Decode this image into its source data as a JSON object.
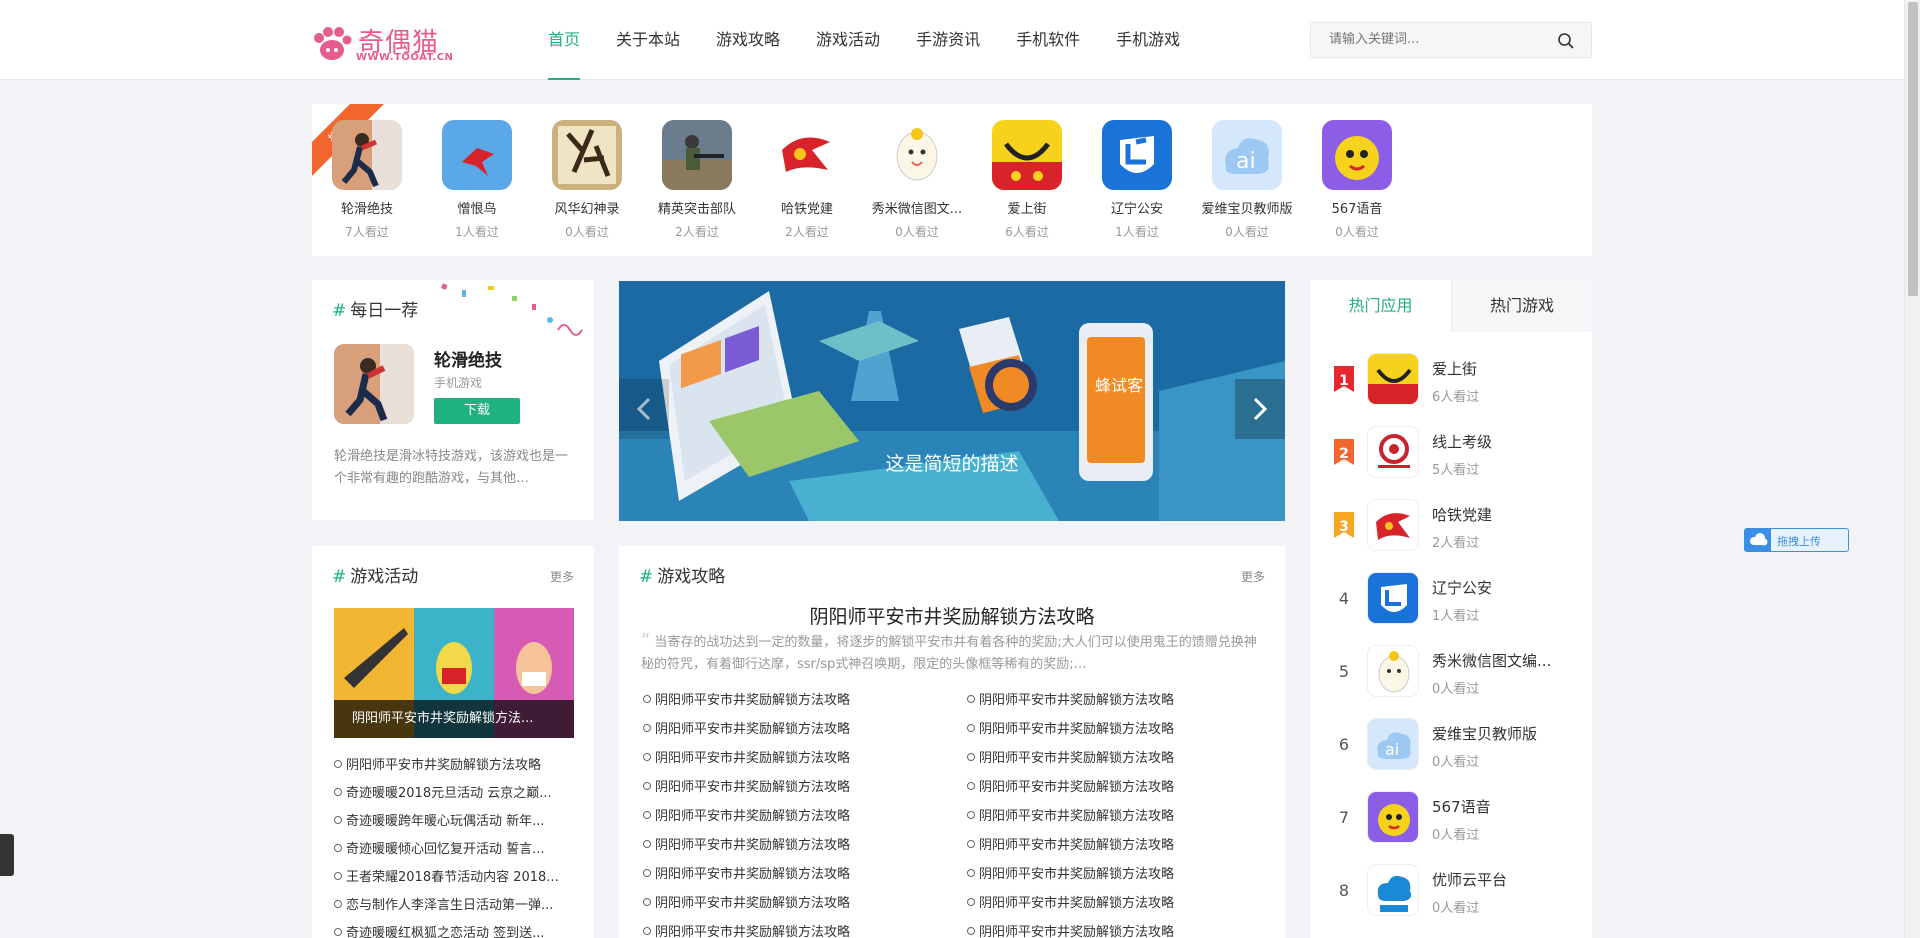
{
  "header": {
    "logo_text": "奇偶猫",
    "logo_url": "WWW.TOOAT.CN",
    "nav": [
      "首页",
      "关于本站",
      "游戏攻略",
      "游戏活动",
      "手游资讯",
      "手机软件",
      "手机游戏"
    ],
    "search_placeholder": "请输入关键词..."
  },
  "recommend": {
    "ribbon": "推荐",
    "items": [
      {
        "name": "轮滑绝技",
        "views": "7人看过"
      },
      {
        "name": "憎恨鸟",
        "views": "1人看过"
      },
      {
        "name": "风华幻神录",
        "views": "0人看过"
      },
      {
        "name": "精英突击部队",
        "views": "2人看过"
      },
      {
        "name": "哈铁党建",
        "views": "2人看过"
      },
      {
        "name": "秀米微信图文...",
        "views": "0人看过"
      },
      {
        "name": "爱上街",
        "views": "6人看过"
      },
      {
        "name": "辽宁公安",
        "views": "1人看过"
      },
      {
        "name": "爱维宝贝教师版",
        "views": "0人看过"
      },
      {
        "name": "567语音",
        "views": "0人看过"
      }
    ]
  },
  "daily": {
    "title": "每日一荐",
    "game_name": "轮滑绝技",
    "category": "手机游戏",
    "download_label": "下载",
    "description": "轮滑绝技是滑冰特技游戏，该游戏也是一个非常有趣的跑酷游戏，与其他…"
  },
  "banner": {
    "caption": "这是简短的描述",
    "phone_sign": "蜂试客"
  },
  "activity": {
    "title": "游戏活动",
    "more": "更多",
    "cover_title": "阴阳师平安市井奖励解锁方法...",
    "items": [
      "阴阳师平安市井奖励解锁方法攻略",
      "奇迹暖暖2018元旦活动 云京之巅...",
      "奇迹暖暖跨年暖心玩偶活动 新年...",
      "奇迹暖暖倾心回忆复开活动 誓言...",
      "王者荣耀2018春节活动内容 2018...",
      "恋与制作人李泽言生日活动第一弹...",
      "奇迹暖暖红枫狐之恋活动 签到送..."
    ]
  },
  "guide": {
    "title": "游戏攻略",
    "more": "更多",
    "headline": "阴阳师平安市井奖励解锁方法攻略",
    "summary": "当寄存的战功达到一定的数量，将逐步的解锁平安市井有着各种的奖励;大人们可以使用鬼王的馈赠兑换神秘的符咒，有着御行达摩，ssr/sp式神召唤期，限定的头像框等稀有的奖励;…",
    "col1": [
      "阴阳师平安市井奖励解锁方法攻略",
      "阴阳师平安市井奖励解锁方法攻略",
      "阴阳师平安市井奖励解锁方法攻略",
      "阴阳师平安市井奖励解锁方法攻略",
      "阴阳师平安市井奖励解锁方法攻略",
      "阴阳师平安市井奖励解锁方法攻略",
      "阴阳师平安市井奖励解锁方法攻略",
      "阴阳师平安市井奖励解锁方法攻略",
      "阴阳师平安市井奖励解锁方法攻略"
    ],
    "col2": [
      "阴阳师平安市井奖励解锁方法攻略",
      "阴阳师平安市井奖励解锁方法攻略",
      "阴阳师平安市井奖励解锁方法攻略",
      "阴阳师平安市井奖励解锁方法攻略",
      "阴阳师平安市井奖励解锁方法攻略",
      "阴阳师平安市井奖励解锁方法攻略",
      "阴阳师平安市井奖励解锁方法攻略",
      "阴阳师平安市井奖励解锁方法攻略",
      "阴阳师平安市井奖励解锁方法攻略"
    ]
  },
  "hot": {
    "tabs": [
      "热门应用",
      "热门游戏"
    ],
    "items": [
      {
        "rank": "1",
        "name": "爱上街",
        "views": "6人看过"
      },
      {
        "rank": "2",
        "name": "线上考级",
        "views": "5人看过"
      },
      {
        "rank": "3",
        "name": "哈铁党建",
        "views": "2人看过"
      },
      {
        "rank": "4",
        "name": "辽宁公安",
        "views": "1人看过"
      },
      {
        "rank": "5",
        "name": "秀米微信图文编...",
        "views": "0人看过"
      },
      {
        "rank": "6",
        "name": "爱维宝贝教师版",
        "views": "0人看过"
      },
      {
        "rank": "7",
        "name": "567语音",
        "views": "0人看过"
      },
      {
        "rank": "8",
        "name": "优师云平台",
        "views": "0人看过"
      }
    ]
  },
  "uploader": {
    "label": "拖拽上传"
  },
  "colors": {
    "accent": "#1fb181",
    "ribbon": "#f2662e",
    "rank1": "#e8262d",
    "rank2": "#f2662e",
    "rank3": "#f5a623",
    "upload": "#3a8ee6"
  }
}
